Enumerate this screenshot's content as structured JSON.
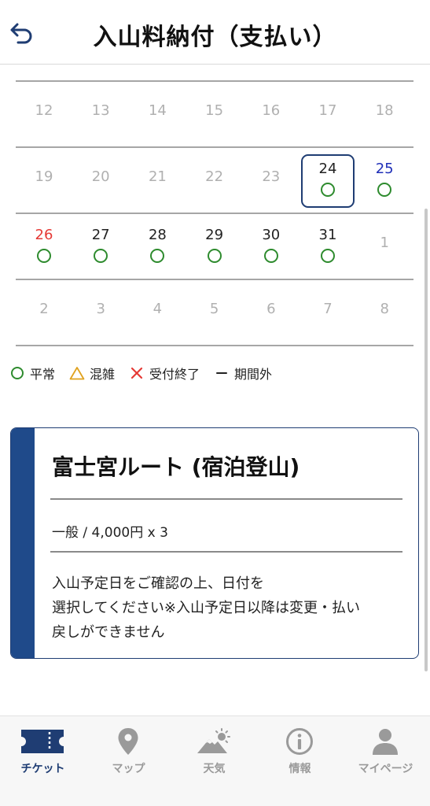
{
  "header": {
    "title": "入山料納付（支払い）",
    "back_icon": "back-arrow-icon"
  },
  "calendar": {
    "weeks": [
      {
        "days": [
          {
            "label": "12",
            "state": "disabled"
          },
          {
            "label": "13",
            "state": "disabled"
          },
          {
            "label": "14",
            "state": "disabled"
          },
          {
            "label": "15",
            "state": "disabled"
          },
          {
            "label": "16",
            "state": "disabled"
          },
          {
            "label": "17",
            "state": "disabled"
          },
          {
            "label": "18",
            "state": "disabled"
          }
        ]
      },
      {
        "days": [
          {
            "label": "19",
            "state": "disabled"
          },
          {
            "label": "20",
            "state": "disabled"
          },
          {
            "label": "21",
            "state": "disabled"
          },
          {
            "label": "22",
            "state": "disabled"
          },
          {
            "label": "23",
            "state": "disabled"
          },
          {
            "label": "24",
            "state": "available",
            "status": "normal",
            "selected": true
          },
          {
            "label": "25",
            "state": "available",
            "status": "normal",
            "weekday": "sat"
          }
        ]
      },
      {
        "days": [
          {
            "label": "26",
            "state": "available",
            "status": "normal",
            "weekday": "sun"
          },
          {
            "label": "27",
            "state": "available",
            "status": "normal"
          },
          {
            "label": "28",
            "state": "available",
            "status": "normal"
          },
          {
            "label": "29",
            "state": "available",
            "status": "normal"
          },
          {
            "label": "30",
            "state": "available",
            "status": "normal"
          },
          {
            "label": "31",
            "state": "available",
            "status": "normal"
          },
          {
            "label": "1",
            "state": "disabled"
          }
        ]
      },
      {
        "days": [
          {
            "label": "2",
            "state": "disabled"
          },
          {
            "label": "3",
            "state": "disabled"
          },
          {
            "label": "4",
            "state": "disabled"
          },
          {
            "label": "5",
            "state": "disabled"
          },
          {
            "label": "6",
            "state": "disabled"
          },
          {
            "label": "7",
            "state": "disabled"
          },
          {
            "label": "8",
            "state": "disabled"
          }
        ]
      }
    ],
    "colors": {
      "sunday": "#e53935",
      "saturday": "#1f2fb8",
      "available_mark": "#2e8b2e",
      "selected_border": "#1f3d73"
    }
  },
  "legend": {
    "normal": "平常",
    "crowded": "混雑",
    "closed": "受付終了",
    "out_of_period": "期間外"
  },
  "route_card": {
    "title": "富士宮ルート (宿泊登山)",
    "price_line": "一般 / 4,000円 x 3",
    "note_line1": "入山予定日をご確認の上、日付を",
    "note_line2": "選択してください※入山予定日以降は変更・払い",
    "note_line3": "戻しができません",
    "accent_color": "#1f4a8a"
  },
  "bottom_nav": {
    "items": [
      {
        "label": "チケット",
        "icon": "ticket-icon",
        "active": true
      },
      {
        "label": "マップ",
        "icon": "map-pin-icon",
        "active": false
      },
      {
        "label": "天気",
        "icon": "weather-icon",
        "active": false
      },
      {
        "label": "情報",
        "icon": "info-icon",
        "active": false
      },
      {
        "label": "マイページ",
        "icon": "person-icon",
        "active": false
      }
    ],
    "active_color": "#1f3d73",
    "inactive_color": "#9a9a9a"
  }
}
